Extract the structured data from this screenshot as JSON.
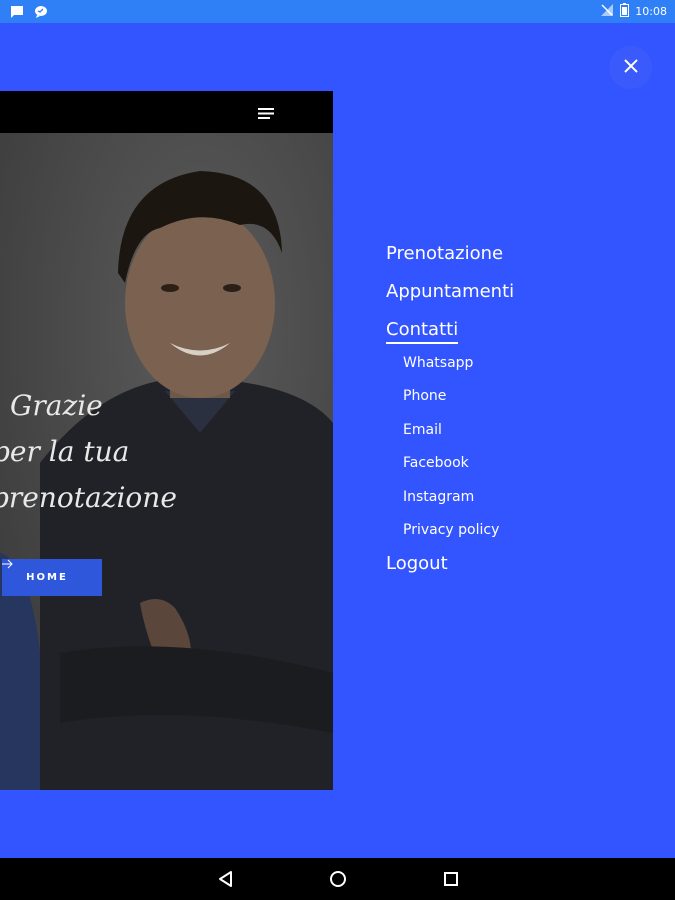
{
  "status_bar": {
    "time": "10:08",
    "left_icons": [
      "message-icon",
      "chat-bubble-icon"
    ],
    "right_icons": [
      "no-signal-icon",
      "battery-icon"
    ]
  },
  "preview": {
    "thanks_lines": [
      "Grazie",
      "per la tua",
      "prenotazione"
    ],
    "home_button_label": "HOME"
  },
  "menu": {
    "items": [
      {
        "label": "Prenotazione"
      },
      {
        "label": "Appuntamenti"
      },
      {
        "label": "Contatti",
        "active": true
      },
      {
        "label": "Logout"
      }
    ],
    "contatti_subitems": [
      "Whatsapp",
      "Phone",
      "Email",
      "Facebook",
      "Instagram",
      "Privacy policy"
    ]
  },
  "colors": {
    "background": "#3355ff",
    "status_bar": "#2f80f6",
    "home_button": "#2f57dc"
  }
}
